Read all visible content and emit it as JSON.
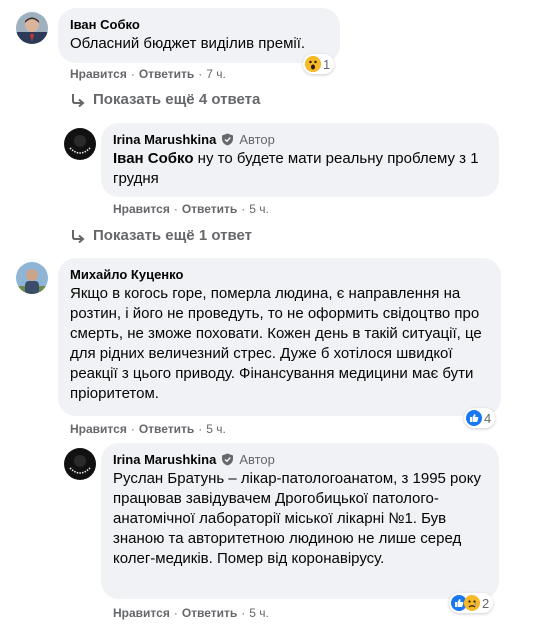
{
  "comments": [
    {
      "author": "Іван Собко",
      "text": "Обласний бюджет виділив премії.",
      "like": "Нравится",
      "reply": "Ответить",
      "time": "7 ч.",
      "reaction_count": "1"
    },
    {
      "author": "Irina Marushkina",
      "badge": "Автор",
      "mention": "Іван Собко",
      "text": " ну то будете мати реальну проблему з 1 грудня",
      "like": "Нравится",
      "reply": "Ответить",
      "time": "5 ч."
    },
    {
      "author": "Михайло Куценко",
      "text": "Якщо в когось горе, померла людина, є направлення на розтин, і його не проведуть, то не оформить свідоцтво про смерть, не зможе поховати. Кожен день в такій ситуації, це для рідних величезний стрес. Дуже б хотілося швидкої реакції з цього приводу. Фінансування медицини має бути пріоритетом.",
      "like": "Нравится",
      "reply": "Ответить",
      "time": "5 ч.",
      "reaction_count": "4"
    },
    {
      "author": "Irina Marushkina",
      "badge": "Автор",
      "text": "Руслан Братунь – лікар-патологоанатом, з 1995 року працював завідувачем Дрогобицької патолого-анатомічної лабораторії міської лікарні №1. Був знаною та авторитетною людиною не лише серед колег-медиків. Помер від коронавірусу.",
      "like": "Нравится",
      "reply": "Ответить",
      "time": "5 ч.",
      "reaction_count": "2"
    }
  ],
  "more_replies": [
    "Показать ещё 4 ответа",
    "Показать ещё 1 ответ"
  ],
  "colors": {
    "bubble": "#f0f2f5",
    "secondary_text": "#65676b",
    "like_blue": "#1877f2"
  }
}
